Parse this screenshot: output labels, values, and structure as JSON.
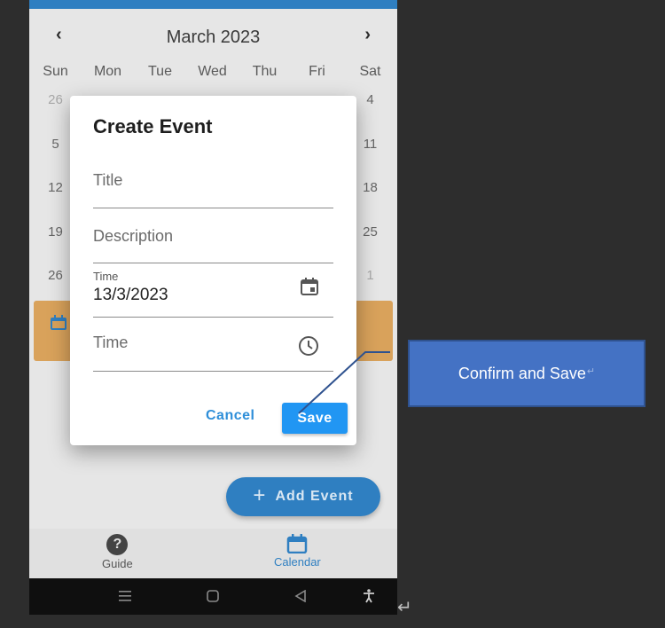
{
  "calendar": {
    "month_title": "March 2023",
    "prev_arrow": "‹",
    "next_arrow": "›",
    "weekdays": [
      "Sun",
      "Mon",
      "Tue",
      "Wed",
      "Thu",
      "Fri",
      "Sat"
    ],
    "visible_days": {
      "row1_sun": "26",
      "row1_sat": "4",
      "row2_sun": "5",
      "row2_sat": "11",
      "row3_sun": "12",
      "row3_sat": "18",
      "row4_sun": "19",
      "row4_sat": "25",
      "row5_sun": "26",
      "row5_sat": "1"
    }
  },
  "dialog": {
    "title": "Create Event",
    "title_placeholder": "Title",
    "description_placeholder": "Description",
    "date_label": "Time",
    "date_value": "13/3/2023",
    "time_placeholder": "Time",
    "cancel_label": "Cancel",
    "save_label": "Save"
  },
  "fab": {
    "plus": "+",
    "label": "Add Event"
  },
  "bottom_nav": {
    "guide_label": "Guide",
    "calendar_label": "Calendar",
    "guide_glyph": "?"
  },
  "callout": {
    "text": "Confirm and Save",
    "return_glyph": "↵"
  },
  "page_return_glyph": "↵",
  "colors": {
    "primary": "#2196f3",
    "app_blue": "#2f7fc1",
    "event_card": "#d9a25b",
    "callout_fill": "#4472c4",
    "callout_border": "#2f528f",
    "background": "#2d2d2d"
  },
  "icons": {
    "date_field": "calendar-icon",
    "time_field": "clock-icon",
    "nav_guide": "help-icon",
    "nav_calendar": "calendar-icon",
    "android_recents": "recents-icon",
    "android_home": "home-icon",
    "android_back": "back-icon",
    "android_accessibility": "accessibility-icon"
  }
}
